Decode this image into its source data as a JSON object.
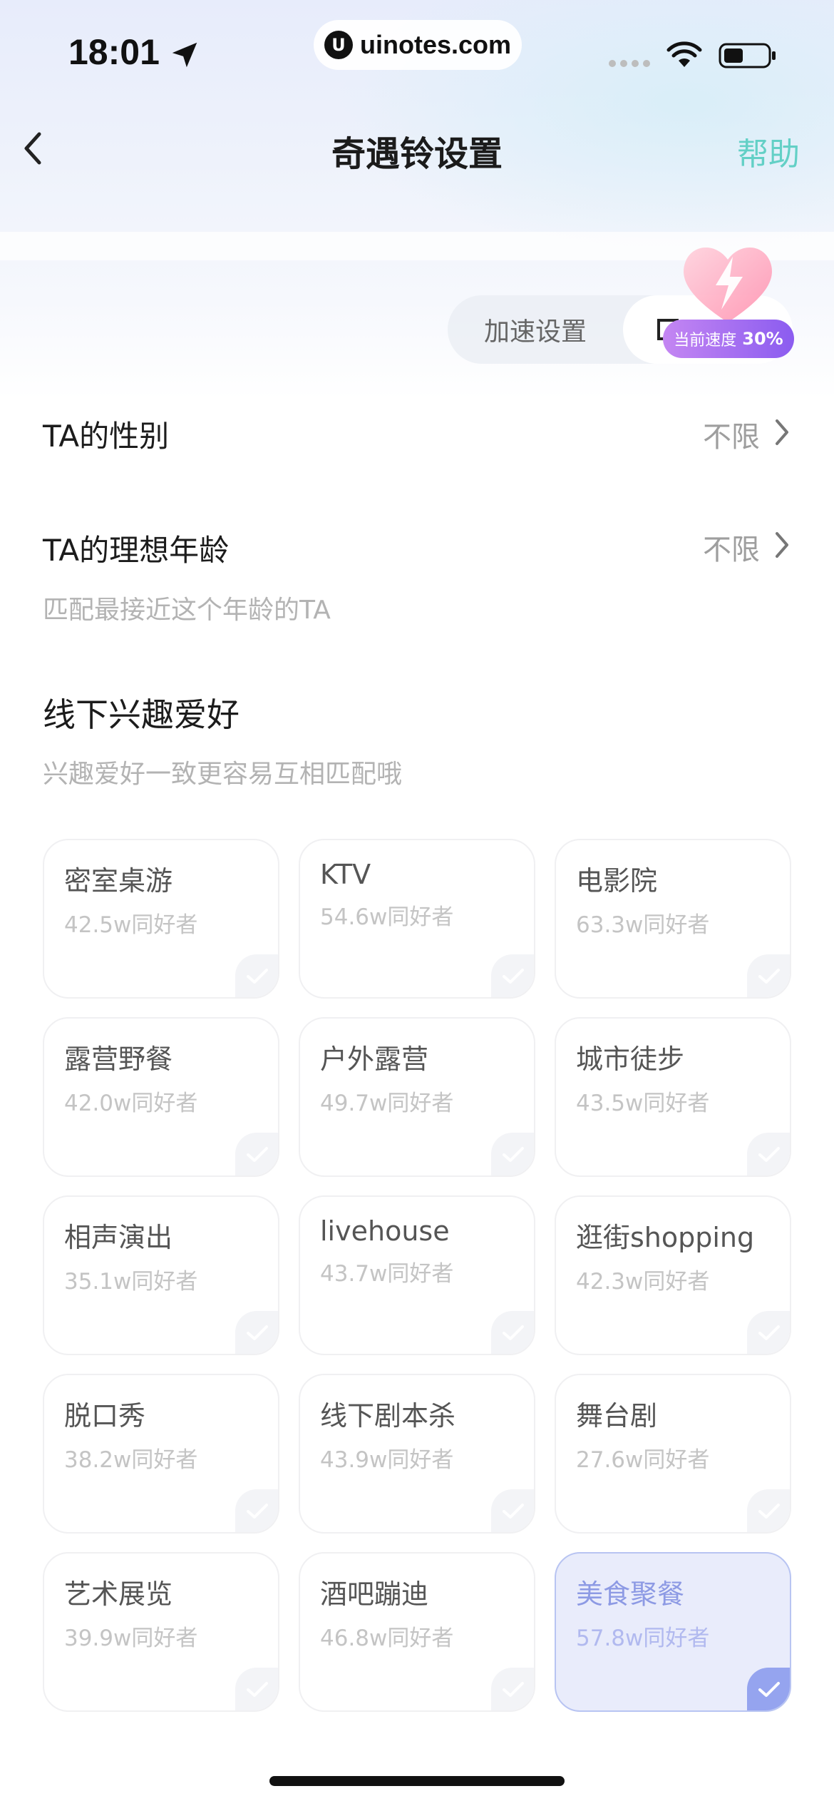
{
  "status_bar": {
    "time": "18:01",
    "url": "uinotes.com"
  },
  "nav": {
    "title": "奇遇铃设置",
    "help_label": "帮助"
  },
  "segmented": {
    "accel_label": "加速设置",
    "speed_label": "当前速度",
    "speed_value": "30%"
  },
  "gender": {
    "label": "TA的性别",
    "value": "不限"
  },
  "age": {
    "label": "TA的理想年龄",
    "value": "不限",
    "sub": "匹配最接近这个年龄的TA"
  },
  "hobbies": {
    "title": "线下兴趣爱好",
    "subtitle": "兴趣爱好一致更容易互相匹配哦",
    "items": [
      {
        "name": "密室桌游",
        "count": "42.5w同好者",
        "selected": false
      },
      {
        "name": "KTV",
        "count": "54.6w同好者",
        "selected": false
      },
      {
        "name": "电影院",
        "count": "63.3w同好者",
        "selected": false
      },
      {
        "name": "露营野餐",
        "count": "42.0w同好者",
        "selected": false
      },
      {
        "name": "户外露营",
        "count": "49.7w同好者",
        "selected": false
      },
      {
        "name": "城市徒步",
        "count": "43.5w同好者",
        "selected": false
      },
      {
        "name": "相声演出",
        "count": "35.1w同好者",
        "selected": false
      },
      {
        "name": "livehouse",
        "count": "43.7w同好者",
        "selected": false
      },
      {
        "name": "逛街shopping",
        "count": "42.3w同好者",
        "selected": false
      },
      {
        "name": "脱口秀",
        "count": "38.2w同好者",
        "selected": false
      },
      {
        "name": "线下剧本杀",
        "count": "43.9w同好者",
        "selected": false
      },
      {
        "name": "舞台剧",
        "count": "27.6w同好者",
        "selected": false
      },
      {
        "name": "艺术展览",
        "count": "39.9w同好者",
        "selected": false
      },
      {
        "name": "酒吧蹦迪",
        "count": "46.8w同好者",
        "selected": false
      },
      {
        "name": "美食聚餐",
        "count": "57.8w同好者",
        "selected": true
      }
    ]
  },
  "colors": {
    "accent_help": "#63d0c6",
    "selected_bg": "#e9ecfb",
    "badge": "#8b5cf0"
  }
}
